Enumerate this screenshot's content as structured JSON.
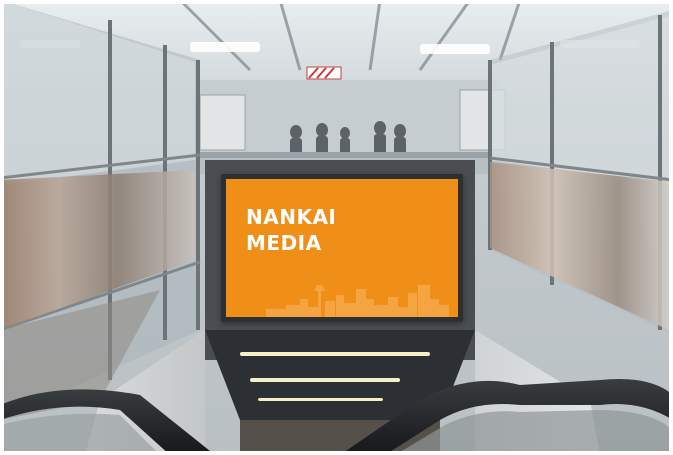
{
  "billboard": {
    "line1": "NANKAI",
    "line2": "MEDIA",
    "background_color": "#ef8f18",
    "text_color": "#ffffff"
  },
  "scene": {
    "skyline_icon": "city-skyline-icon"
  }
}
